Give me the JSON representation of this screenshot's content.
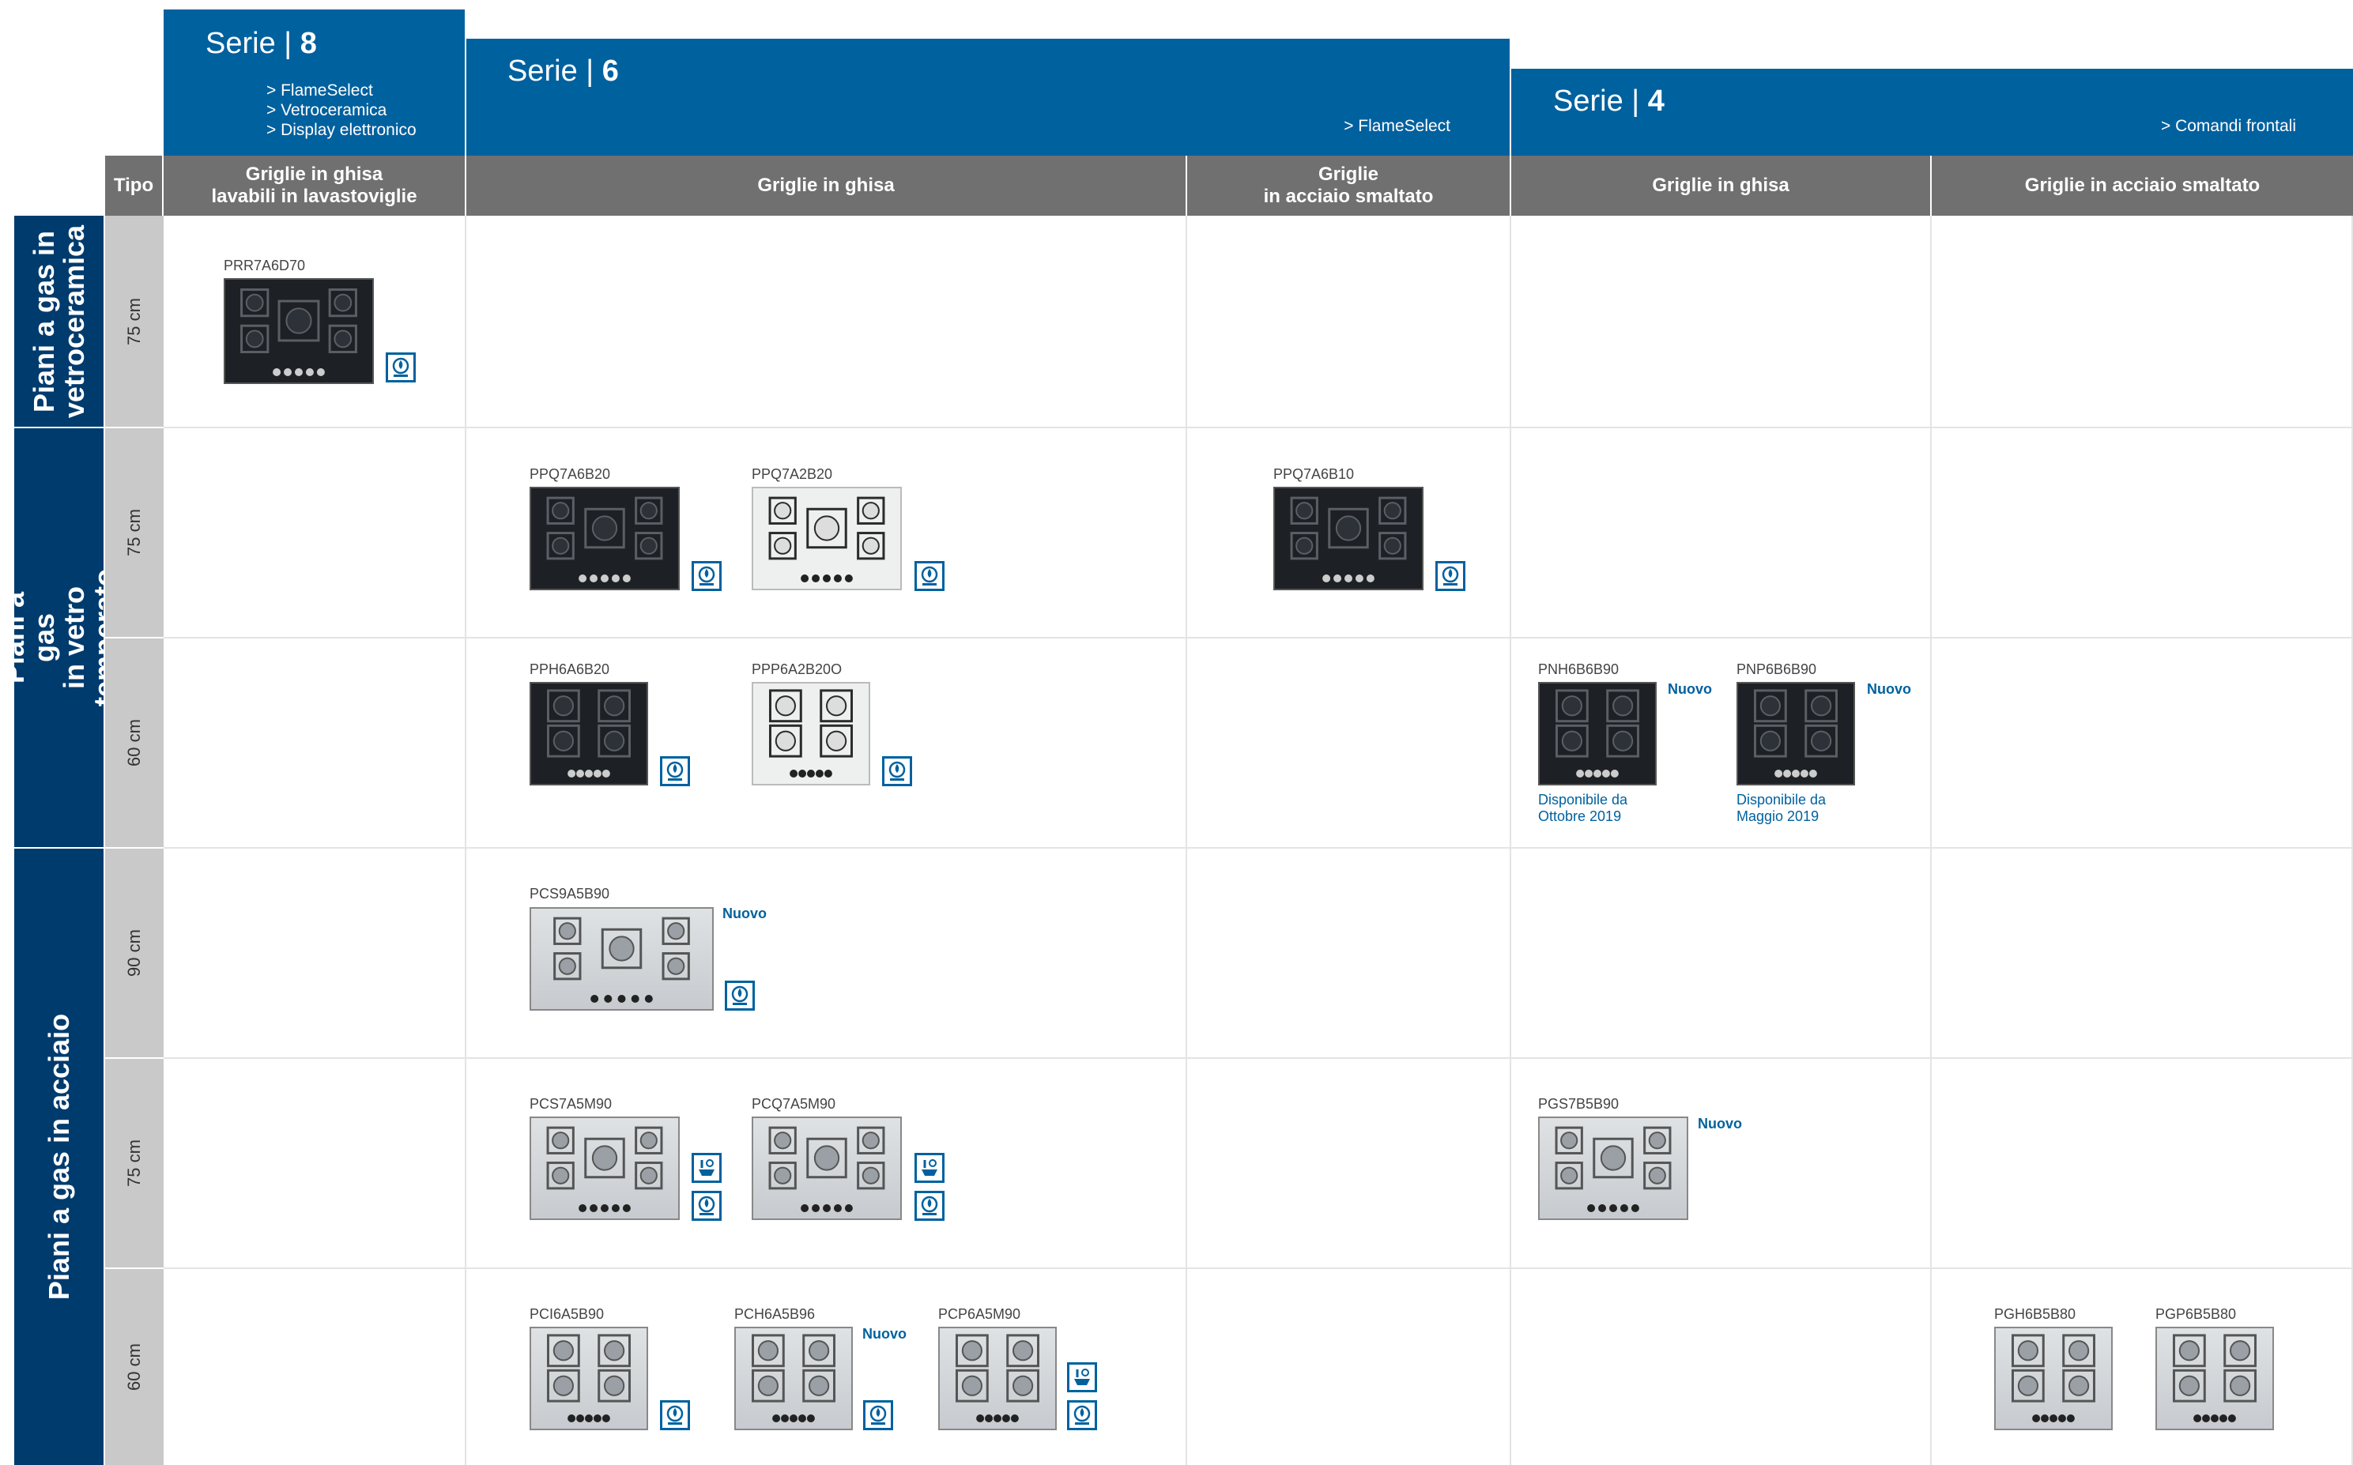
{
  "series": {
    "s8": {
      "label": "Serie",
      "num": "8",
      "features": [
        "> FlameSelect",
        "> Vetroceramica",
        "> Display elettronico"
      ]
    },
    "s6": {
      "label": "Serie",
      "num": "6",
      "features": [
        "> FlameSelect"
      ]
    },
    "s4": {
      "label": "Serie",
      "num": "4",
      "features": [
        "> Comandi frontali"
      ]
    }
  },
  "categories": {
    "tipo": "Tipo",
    "c1": "Griglie in ghisa\nlavabili in lavastoviglie",
    "c2": "Griglie in ghisa",
    "c3": "Griglie\nin acciaio smaltato",
    "c4": "Griglie in ghisa",
    "c5": "Griglie in acciaio smaltato"
  },
  "groups": {
    "g1": "Piani a gas in\nvetroceramica",
    "g2": "Piani a gas\nin vetro temperato",
    "g3": "Piani a gas in acciaio"
  },
  "sizes": {
    "r1": "75 cm",
    "r2": "75 cm",
    "r3": "60 cm",
    "r4": "90 cm",
    "r5": "75 cm",
    "r6": "60 cm"
  },
  "badges": {
    "flame": "flameselect-icon",
    "control": "control-icon"
  },
  "products": {
    "PRR7A6D70": {
      "code": "PRR7A6D70"
    },
    "PPQ7A6B20": {
      "code": "PPQ7A6B20"
    },
    "PPQ7A2B20": {
      "code": "PPQ7A2B20"
    },
    "PPQ7A6B10": {
      "code": "PPQ7A6B10"
    },
    "PPH6A6B20": {
      "code": "PPH6A6B20"
    },
    "PPP6A2B20O": {
      "code": "PPP6A2B20O"
    },
    "PNH6B6B90": {
      "code": "PNH6B6B90",
      "badge": "Nuovo",
      "note": "Disponibile da\nOttobre 2019"
    },
    "PNP6B6B90": {
      "code": "PNP6B6B90",
      "badge": "Nuovo",
      "note": "Disponibile da\nMaggio 2019"
    },
    "PCS9A5B90": {
      "code": "PCS9A5B90",
      "badge": "Nuovo"
    },
    "PCS7A5M90": {
      "code": "PCS7A5M90"
    },
    "PCQ7A5M90": {
      "code": "PCQ7A5M90"
    },
    "PGS7B5B90": {
      "code": "PGS7B5B90",
      "badge": "Nuovo"
    },
    "PCI6A5B90": {
      "code": "PCI6A5B90"
    },
    "PCH6A5B96": {
      "code": "PCH6A5B96",
      "badge": "Nuovo"
    },
    "PCP6A5M90": {
      "code": "PCP6A5M90"
    },
    "PGH6B5B80": {
      "code": "PGH6B5B80"
    },
    "PGP6B5B80": {
      "code": "PGP6B5B80"
    }
  }
}
